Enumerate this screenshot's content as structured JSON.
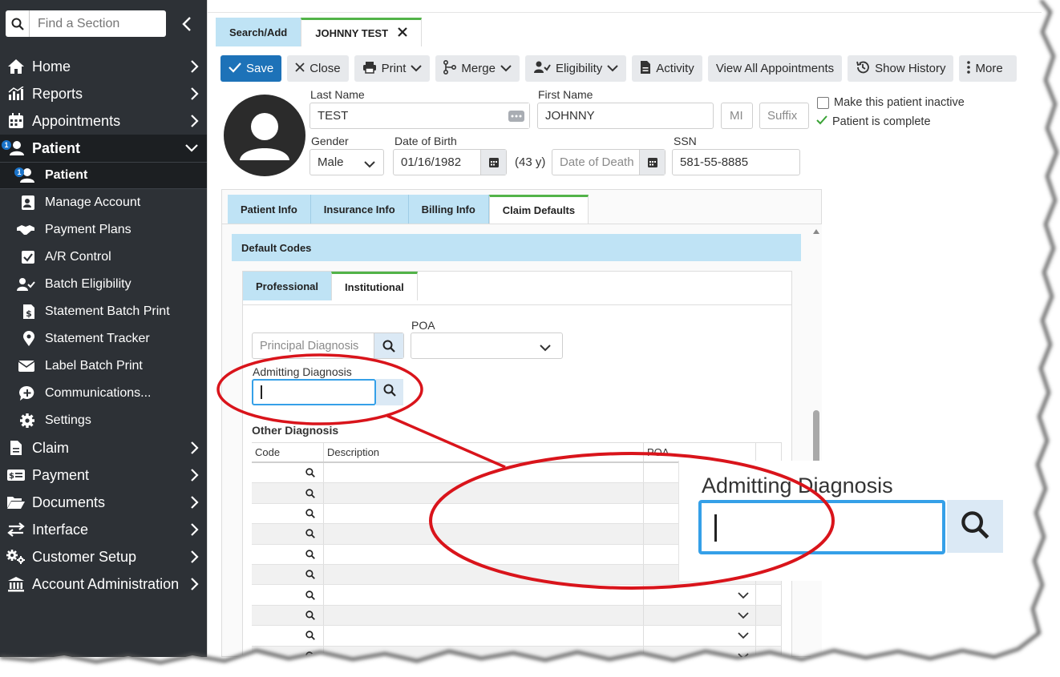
{
  "sidebar": {
    "search_placeholder": "Find a Section",
    "items": [
      {
        "label": "Home"
      },
      {
        "label": "Reports"
      },
      {
        "label": "Appointments"
      },
      {
        "label": "Patient",
        "badge": "1"
      },
      {
        "label": "Claim"
      },
      {
        "label": "Payment"
      },
      {
        "label": "Documents"
      },
      {
        "label": "Interface"
      },
      {
        "label": "Customer Setup"
      },
      {
        "label": "Account Administration"
      }
    ],
    "sub_items": [
      {
        "label": "Patient",
        "badge": "1"
      },
      {
        "label": "Manage Account"
      },
      {
        "label": "Payment Plans"
      },
      {
        "label": "A/R Control"
      },
      {
        "label": "Batch Eligibility"
      },
      {
        "label": "Statement Batch Print"
      },
      {
        "label": "Statement Tracker"
      },
      {
        "label": "Label Batch Print"
      },
      {
        "label": "Communications..."
      },
      {
        "label": "Settings"
      }
    ]
  },
  "tabs": {
    "search_add": "Search/Add",
    "patient": "JOHNNY TEST"
  },
  "toolbar": {
    "save": "Save",
    "close": "Close",
    "print": "Print",
    "merge": "Merge",
    "eligibility": "Eligibility",
    "activity": "Activity",
    "view_all": "View All Appointments",
    "show_history": "Show History",
    "more": "More"
  },
  "patient": {
    "last_name_label": "Last Name",
    "last_name": "TEST",
    "first_name_label": "First Name",
    "first_name": "JOHNNY",
    "mi_placeholder": "MI",
    "suffix_placeholder": "Suffix",
    "inactive_label": "Make this patient inactive",
    "complete_label": "Patient is complete",
    "gender_label": "Gender",
    "gender": "Male",
    "dob_label": "Date of Birth",
    "dob": "01/16/1982",
    "age": "(43 y)",
    "dod_placeholder": "Date of Death",
    "ssn_label": "SSN",
    "ssn": "581-55-8885"
  },
  "panel_tabs": [
    "Patient Info",
    "Insurance Info",
    "Billing Info",
    "Claim Defaults"
  ],
  "section_title": "Default Codes",
  "sub_tabs": [
    "Professional",
    "Institutional"
  ],
  "form": {
    "principal_placeholder": "Principal Diagnosis",
    "poa_label": "POA",
    "admitting_label": "Admitting Diagnosis",
    "other_label": "Other Diagnosis"
  },
  "grid": {
    "headers": [
      "Code",
      "Description",
      "POA"
    ]
  },
  "zoom": {
    "label": "Admitting Diagnosis"
  },
  "colors": {
    "sidebar": "#2d3136",
    "accent_blue": "#1d72b8",
    "tab_blue": "#bfe3f5",
    "active_green": "#52b348",
    "callout_red": "#d9141b",
    "focus_blue": "#35a0e8"
  }
}
